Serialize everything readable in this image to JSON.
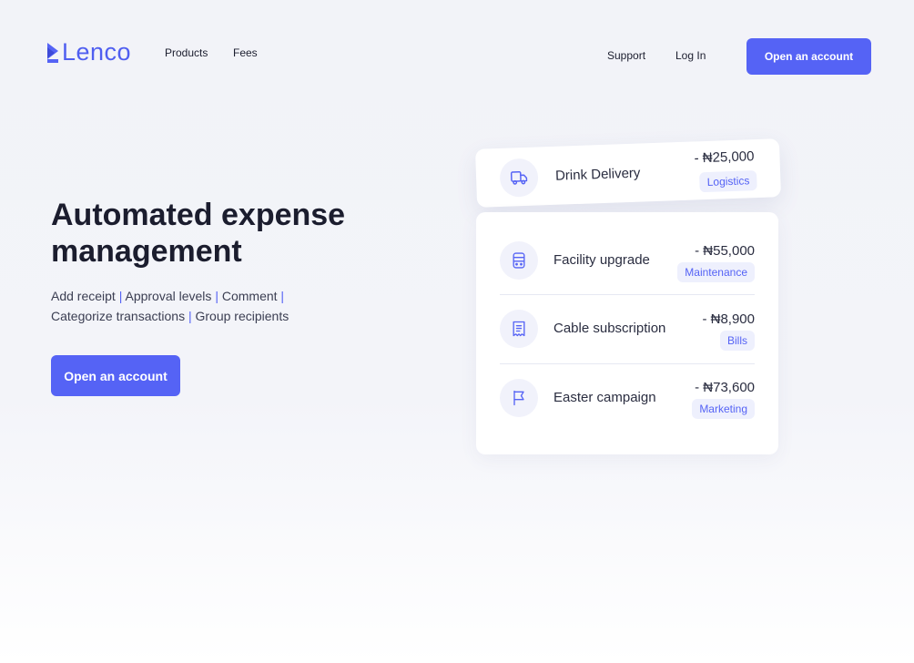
{
  "header": {
    "brand": "Lenco",
    "nav": {
      "products": "Products",
      "fees": "Fees",
      "support": "Support",
      "login": "Log In"
    },
    "cta": "Open an account"
  },
  "hero": {
    "title_line1": "Automated expense",
    "title_line2": "management",
    "features": [
      "Add receipt",
      "Approval levels",
      "Comment",
      "Categorize transactions",
      "Group recipients"
    ],
    "separator": "|",
    "cta": "Open an account"
  },
  "featured_transaction": {
    "title": "Drink Delivery",
    "amount": "- ₦25,000",
    "category": "Logistics",
    "icon": "truck-icon"
  },
  "transactions": [
    {
      "title": "Facility upgrade",
      "amount": "- ₦55,000",
      "category": "Maintenance",
      "icon": "building-icon"
    },
    {
      "title": "Cable subscription",
      "amount": "- ₦8,900",
      "category": "Bills",
      "icon": "receipt-icon"
    },
    {
      "title": "Easter campaign",
      "amount": "- ₦73,600",
      "category": "Marketing",
      "icon": "flag-icon"
    }
  ],
  "colors": {
    "accent": "#5563f5",
    "tag_bg": "#eef0fd",
    "text": "#1b1d2e"
  }
}
